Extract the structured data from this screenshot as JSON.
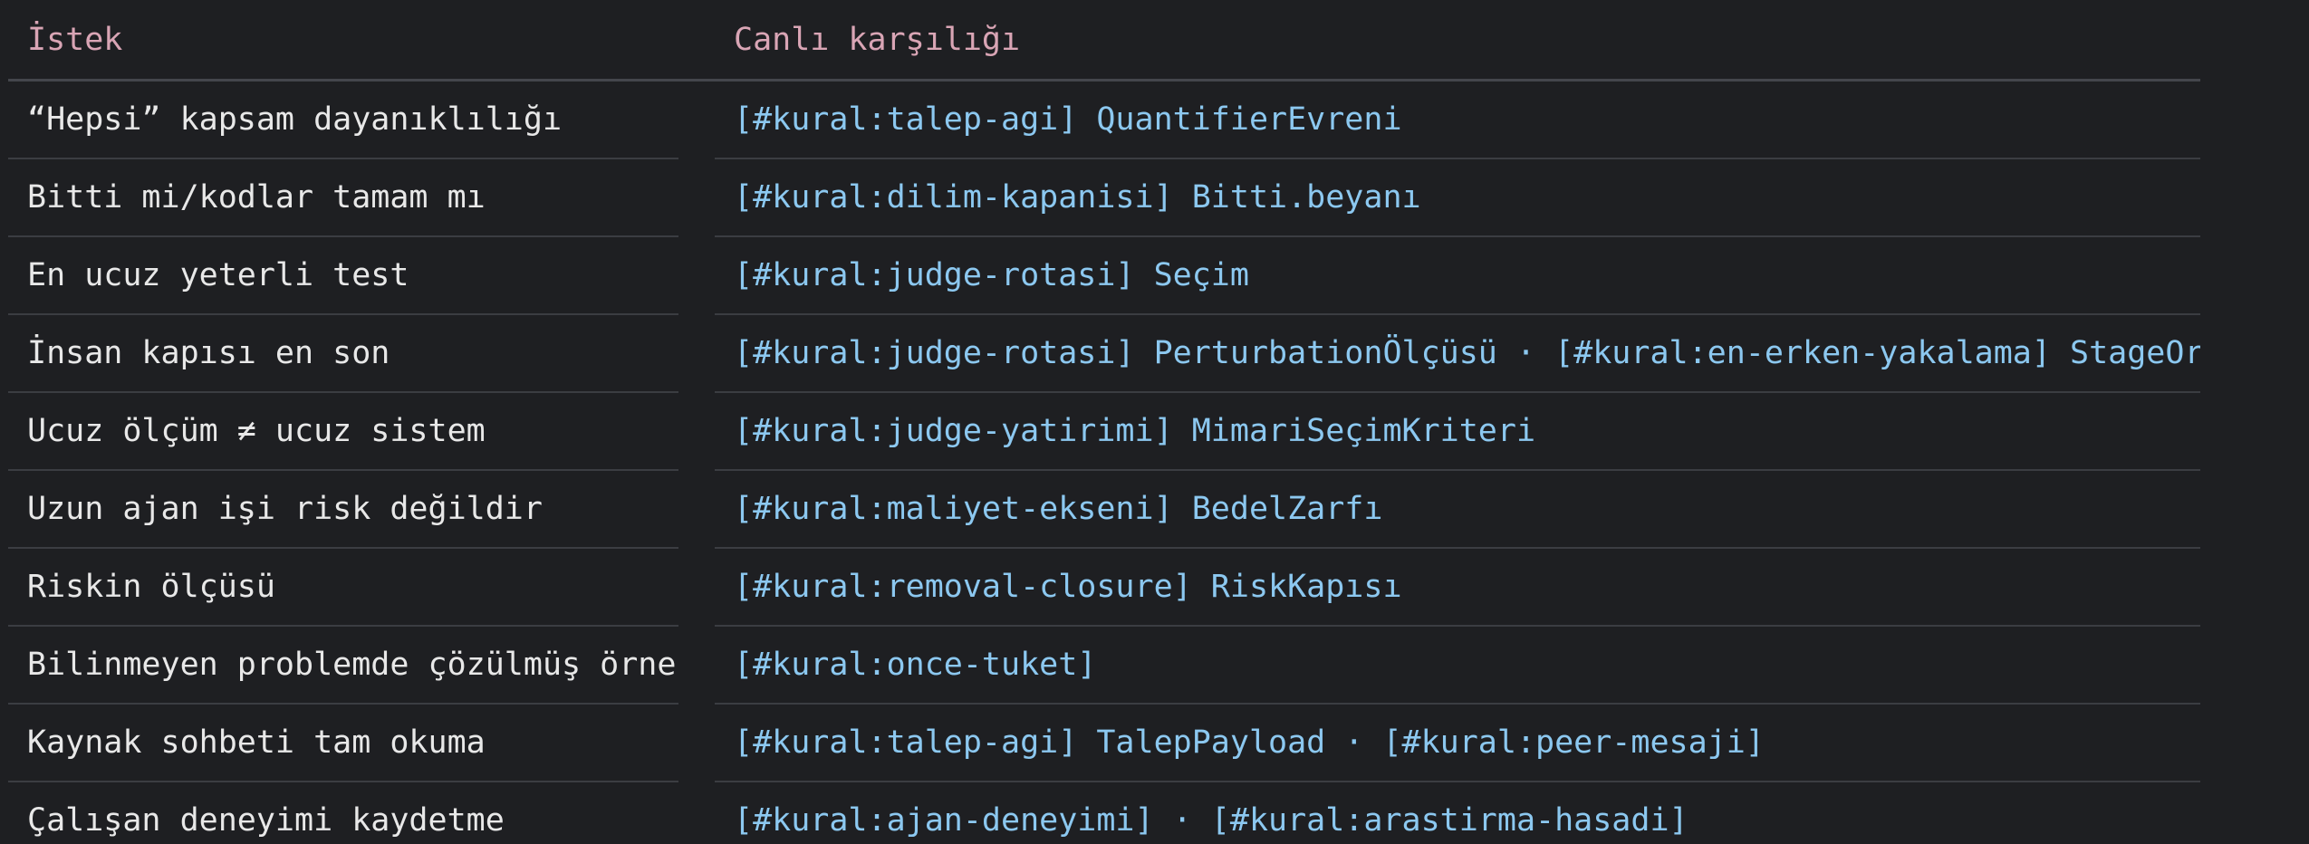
{
  "header": {
    "col1": "İstek",
    "col2": "Canlı karşılığı"
  },
  "rows": [
    {
      "istek": "“Hepsi” kapsam dayanıklılığı",
      "karsilik": "[#kural:talep-agi] QuantifierEvreni"
    },
    {
      "istek": "Bitti mi/kodlar tamam mı",
      "karsilik": "[#kural:dilim-kapanisi] Bitti.beyanı"
    },
    {
      "istek": "En ucuz yeterli test",
      "karsilik": "[#kural:judge-rotasi] Seçim"
    },
    {
      "istek": "İnsan kapısı en son",
      "karsilik": "[#kural:judge-rotasi] PerturbationÖlçüsü · [#kural:en-erken-yakalama] StageOrder"
    },
    {
      "istek": "Ucuz ölçüm ≠ ucuz sistem",
      "karsilik": "[#kural:judge-yatirimi] MimariSeçimKriteri"
    },
    {
      "istek": "Uzun ajan işi risk değildir",
      "karsilik": "[#kural:maliyet-ekseni] BedelZarfı"
    },
    {
      "istek": "Riskin ölçüsü",
      "karsilik": "[#kural:removal-closure] RiskKapısı"
    },
    {
      "istek": "Bilinmeyen problemde çözülmüş örnek",
      "karsilik": "[#kural:once-tuket]"
    },
    {
      "istek": "Kaynak sohbeti tam okuma",
      "karsilik": "[#kural:talep-agi] TalepPayload · [#kural:peer-mesaji]"
    },
    {
      "istek": "Çalışan deneyimi kaydetme",
      "karsilik": "[#kural:ajan-deneyimi] · [#kural:arastirma-hasadi]"
    }
  ]
}
